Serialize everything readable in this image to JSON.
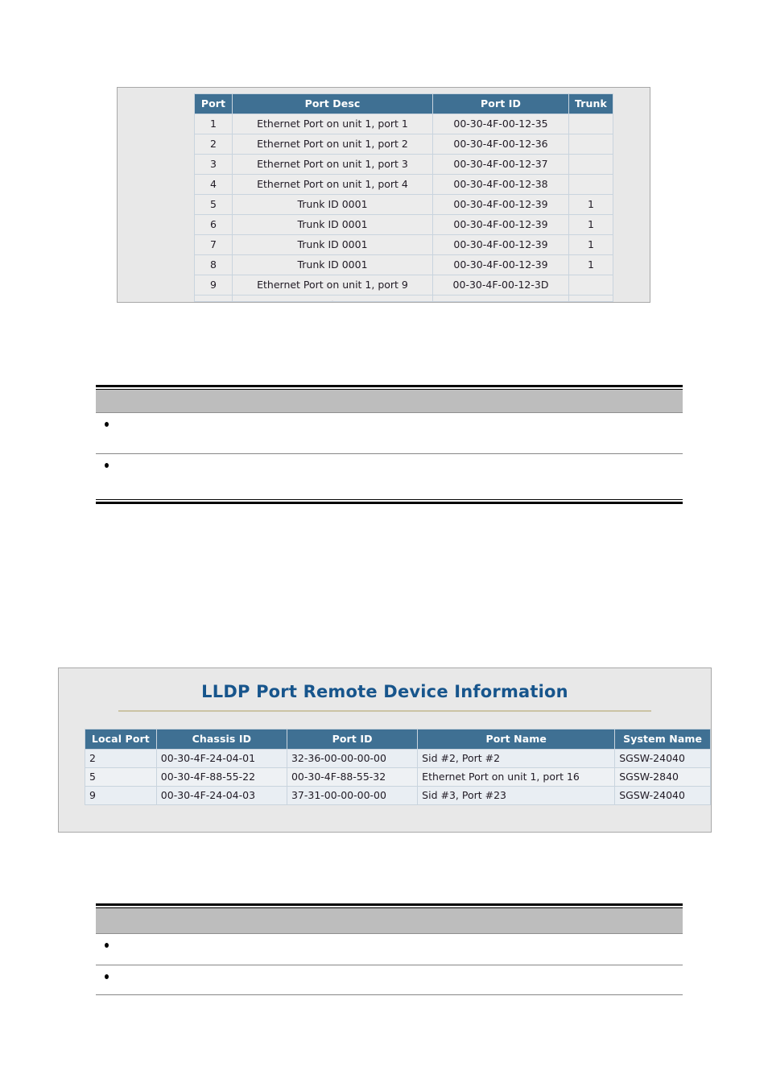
{
  "panels": {
    "local_port_table": {
      "columns": [
        "Port",
        "Port Desc",
        "Port ID",
        "Trunk"
      ],
      "rows": [
        {
          "port": "1",
          "desc": "Ethernet Port on unit 1, port 1",
          "port_id": "00-30-4F-00-12-35",
          "trunk": ""
        },
        {
          "port": "2",
          "desc": "Ethernet Port on unit 1, port 2",
          "port_id": "00-30-4F-00-12-36",
          "trunk": ""
        },
        {
          "port": "3",
          "desc": "Ethernet Port on unit 1, port 3",
          "port_id": "00-30-4F-00-12-37",
          "trunk": ""
        },
        {
          "port": "4",
          "desc": "Ethernet Port on unit 1, port 4",
          "port_id": "00-30-4F-00-12-38",
          "trunk": ""
        },
        {
          "port": "5",
          "desc": "Trunk ID 0001",
          "port_id": "00-30-4F-00-12-39",
          "trunk": "1"
        },
        {
          "port": "6",
          "desc": "Trunk ID 0001",
          "port_id": "00-30-4F-00-12-39",
          "trunk": "1"
        },
        {
          "port": "7",
          "desc": "Trunk ID 0001",
          "port_id": "00-30-4F-00-12-39",
          "trunk": "1"
        },
        {
          "port": "8",
          "desc": "Trunk ID 0001",
          "port_id": "00-30-4F-00-12-39",
          "trunk": "1"
        },
        {
          "port": "9",
          "desc": "Ethernet Port on unit 1, port 9",
          "port_id": "00-30-4F-00-12-3D",
          "trunk": ""
        }
      ],
      "clipped_row": {
        "port": "",
        "desc": ".",
        "port_id": "",
        "trunk": ""
      }
    },
    "lldp_remote": {
      "title": "LLDP Port Remote Device Information",
      "columns": [
        "Local Port",
        "Chassis ID",
        "Port ID",
        "Port Name",
        "System Name"
      ],
      "rows": [
        {
          "local_port": "2",
          "chassis_id": "00-30-4F-24-04-01",
          "port_id": "32-36-00-00-00-00",
          "port_name": "Sid #2, Port #2",
          "system_name": "SGSW-24040"
        },
        {
          "local_port": "5",
          "chassis_id": "00-30-4F-88-55-22",
          "port_id": "00-30-4F-88-55-32",
          "port_name": "Ethernet Port on unit 1, port 16",
          "system_name": "SGSW-2840"
        },
        {
          "local_port": "9",
          "chassis_id": "00-30-4F-24-04-03",
          "port_id": "37-31-00-00-00-00",
          "port_name": "Sid #3, Port #23",
          "system_name": "SGSW-24040"
        }
      ]
    }
  },
  "note_blocks": [
    {
      "header": "",
      "rows": [
        "",
        ""
      ]
    },
    {
      "header": "",
      "rows": [
        "",
        ""
      ]
    }
  ],
  "colors": {
    "table_header_blue": "#3f7093",
    "title_navy": "#17558c",
    "title_rule_tan": "#cbc3a4",
    "panel_bg": "#e8e8e8",
    "cell_gray": "#ececec",
    "cell_blue_gray": "#e9eef3",
    "note_band_gray": "#bdbdbd"
  }
}
